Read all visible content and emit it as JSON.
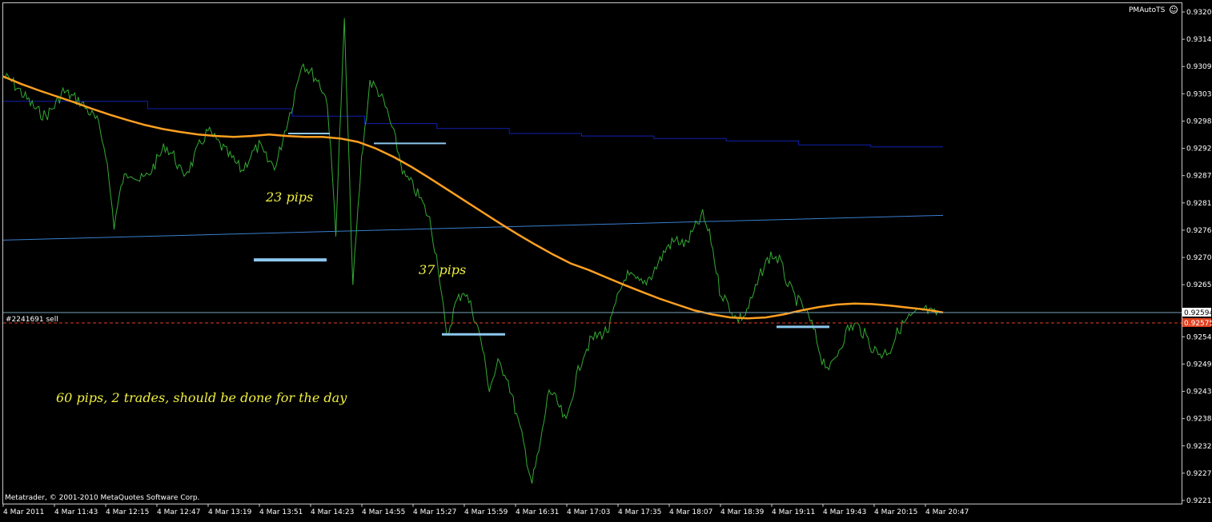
{
  "header": {
    "indicator_label": "PMAutoTS"
  },
  "footer": {
    "copyright": "Metatrader, © 2001-2010 MetaQuotes Software Corp."
  },
  "order": {
    "label": "#2241691 sell"
  },
  "chart_data": {
    "type": "line",
    "title": "",
    "ylim": [
      0.92215,
      0.932
    ],
    "y_ticks": [
      "0.93200",
      "0.93145",
      "0.93090",
      "0.93035",
      "0.92980",
      "0.92925",
      "0.92870",
      "0.92815",
      "0.92760",
      "0.92705",
      "0.92650",
      "0.92594",
      "0.92575",
      "0.92545",
      "0.92490",
      "0.92435",
      "0.92380",
      "0.92325",
      "0.92270",
      "0.92215"
    ],
    "x_ticks": [
      "4 Mar 2011",
      "4 Mar 11:43",
      "4 Mar 12:15",
      "4 Mar 12:47",
      "4 Mar 13:19",
      "4 Mar 13:51",
      "4 Mar 14:23",
      "4 Mar 14:55",
      "4 Mar 15:27",
      "4 Mar 15:59",
      "4 Mar 16:31",
      "4 Mar 17:03",
      "4 Mar 17:35",
      "4 Mar 18:07",
      "4 Mar 18:39",
      "4 Mar 19:11",
      "4 Mar 19:43",
      "4 Mar 20:15",
      "4 Mar 20:47"
    ],
    "current_price": "0.92594",
    "order_price": "0.92575",
    "colors": {
      "price": "#33aa33",
      "ma": "#ffa020",
      "upper": "#1020b0",
      "lower": "#3a7fd0",
      "level": "#8cc8ee",
      "note": "#f0f040"
    },
    "series": [
      {
        "key": "price",
        "values": [
          0.9307,
          0.9306,
          0.9304,
          0.9302,
          0.93,
          0.9299,
          0.9301,
          0.9304,
          0.9303,
          0.9302,
          0.93,
          0.9298,
          0.9292,
          0.9277,
          0.9286,
          0.9288,
          0.9286,
          0.9287,
          0.929,
          0.9293,
          0.9291,
          0.9287,
          0.9289,
          0.9293,
          0.9296,
          0.9294,
          0.9292,
          0.929,
          0.9288,
          0.9291,
          0.9293,
          0.929,
          0.9289,
          0.9296,
          0.9302,
          0.931,
          0.9308,
          0.9306,
          0.9302,
          0.9276,
          0.9318,
          0.9265,
          0.929,
          0.9306,
          0.9304,
          0.93,
          0.9294,
          0.9287,
          0.9285,
          0.9282,
          0.9278,
          0.9269,
          0.9254,
          0.9261,
          0.9264,
          0.926,
          0.9254,
          0.9244,
          0.9249,
          0.9247,
          0.924,
          0.9233,
          0.9225,
          0.9233,
          0.9244,
          0.9241,
          0.9237,
          0.9245,
          0.9251,
          0.9254,
          0.9255,
          0.9256,
          0.9262,
          0.9267,
          0.9266,
          0.9265,
          0.9267,
          0.927,
          0.9273,
          0.9274,
          0.9273,
          0.9276,
          0.9279,
          0.9274,
          0.9264,
          0.9261,
          0.9258,
          0.9259,
          0.9263,
          0.9268,
          0.9271,
          0.927,
          0.9265,
          0.9262,
          0.926,
          0.9256,
          0.925,
          0.9248,
          0.9252,
          0.9256,
          0.9257,
          0.9255,
          0.9252,
          0.9251,
          0.9252,
          0.9256,
          0.9258,
          0.9259,
          0.926,
          0.9259,
          0.92594
        ]
      },
      {
        "key": "ma",
        "values": [
          0.9307,
          0.93055,
          0.93042,
          0.9303,
          0.93018,
          0.93005,
          0.92993,
          0.92982,
          0.92972,
          0.92964,
          0.92958,
          0.92953,
          0.9295,
          0.92948,
          0.9295,
          0.92953,
          0.9295,
          0.92948,
          0.92948,
          0.92945,
          0.92938,
          0.92925,
          0.92908,
          0.92888,
          0.92866,
          0.92843,
          0.9282,
          0.92797,
          0.92774,
          0.92752,
          0.92731,
          0.92711,
          0.92693,
          0.9268,
          0.92665,
          0.9265,
          0.92636,
          0.92622,
          0.9261,
          0.92598,
          0.9259,
          0.92584,
          0.92582,
          0.92584,
          0.9259,
          0.92598,
          0.92605,
          0.9261,
          0.92612,
          0.92611,
          0.92608,
          0.92604,
          0.926,
          0.92594
        ]
      },
      {
        "key": "upper",
        "values": [
          0.9302,
          0.9302,
          0.93005,
          0.93005,
          0.9299,
          0.92975,
          0.92965,
          0.92955,
          0.9295,
          0.92945,
          0.9294,
          0.92932,
          0.92928
        ]
      },
      {
        "key": "lower",
        "values": [
          0.9274,
          0.9279
        ]
      }
    ],
    "annotations": [
      "23 pips",
      "37 pips",
      "60 pips, 2 trades, should be done for the day"
    ]
  }
}
